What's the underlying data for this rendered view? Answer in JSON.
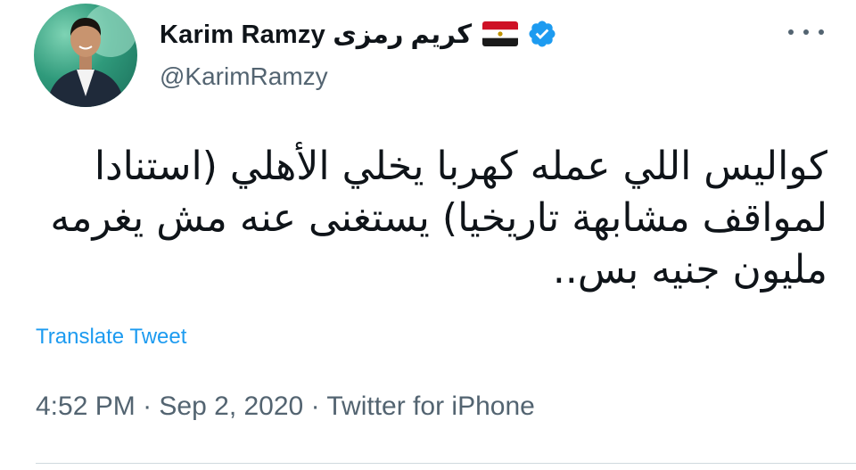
{
  "author": {
    "display_name": "Karim Ramzy كريم رمزى",
    "handle": "@KarimRamzy",
    "flag_icon": "egypt-flag-icon",
    "verified_icon": "verified-badge-icon"
  },
  "tweet": {
    "text": "كواليس اللي عمله كهربا يخلي الأهلي (استنادا لمواقف مشابهة تاريخيا) يستغنى عنه مش يغرمه مليون جنيه بس..",
    "translate_label": "Translate Tweet",
    "time": "4:52 PM",
    "separator": "·",
    "date": "Sep 2, 2020",
    "source": "Twitter for iPhone"
  },
  "colors": {
    "link": "#1d9bf0",
    "secondary_text": "#536471",
    "verified": "#1d9bf0"
  }
}
